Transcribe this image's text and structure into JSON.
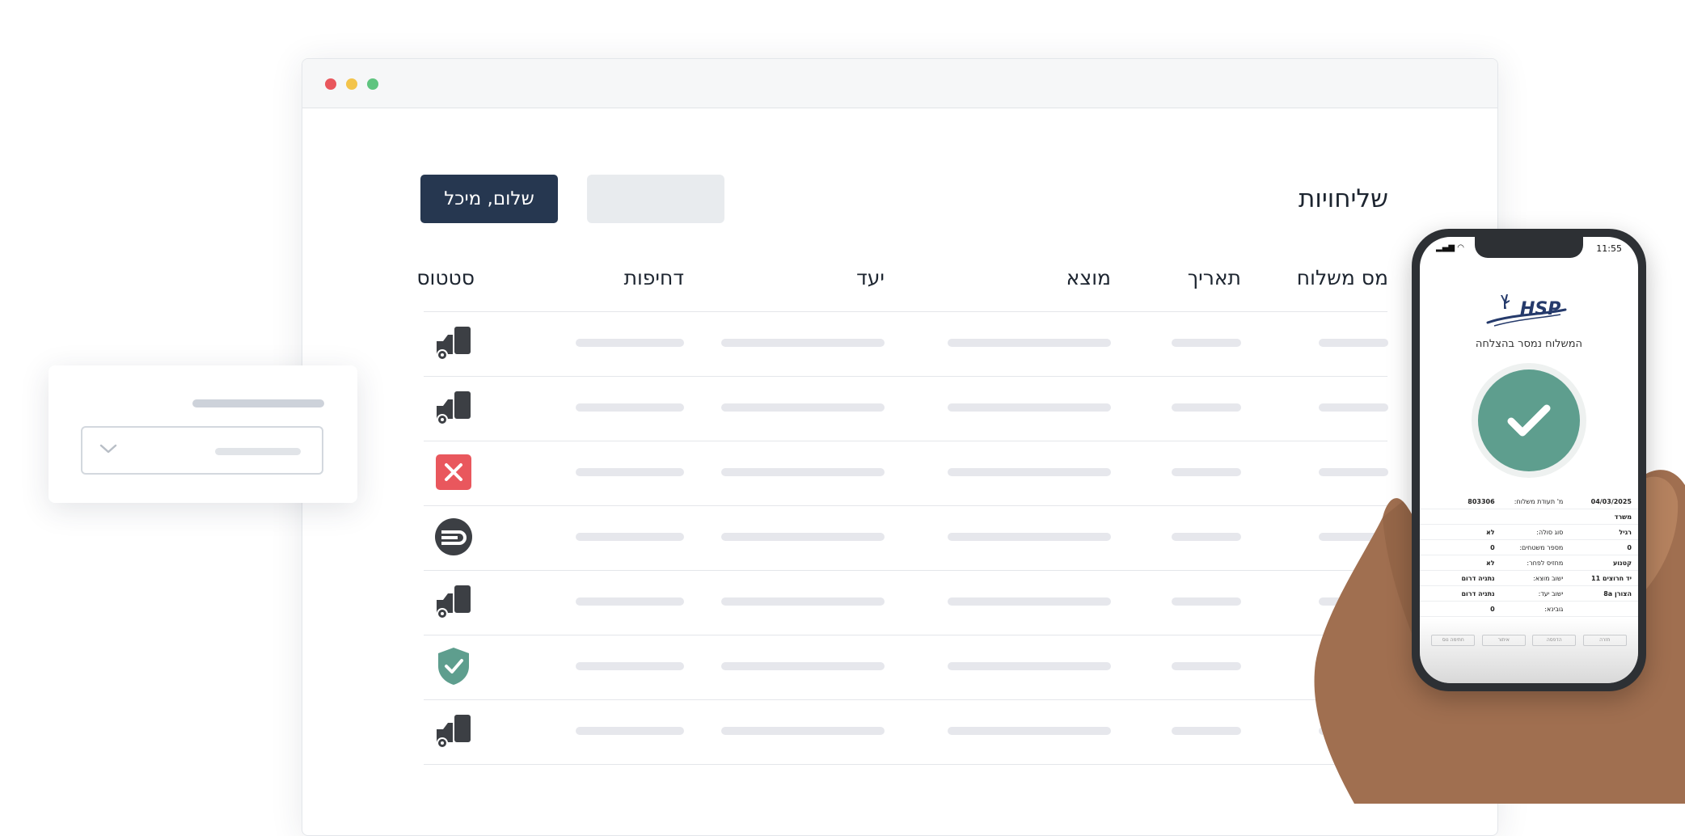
{
  "window": {
    "dots": [
      "red",
      "yellow",
      "green"
    ]
  },
  "header": {
    "title": "שליחויות",
    "greeting_button": "שלום, מיכל"
  },
  "table": {
    "columns": [
      "מס משלוח",
      "תאריך",
      "מוצא",
      "יעד",
      "דחיפות",
      "סטטוס"
    ],
    "rows": [
      {
        "status_icon": "truck-icon"
      },
      {
        "status_icon": "truck-icon"
      },
      {
        "status_icon": "cancel-icon"
      },
      {
        "status_icon": "delivered-package-icon"
      },
      {
        "status_icon": "truck-icon"
      },
      {
        "status_icon": "shield-check-icon"
      },
      {
        "status_icon": "truck-icon"
      }
    ]
  },
  "float_card": {
    "icon": "chevron-down-icon"
  },
  "phone": {
    "time": "11:55",
    "logo_text": "HSP",
    "success_message": "המשלוח נמסר בהצלחה",
    "details": [
      [
        "04/03/2025",
        "מ' תעודת משלוח:",
        "803306"
      ],
      [
        "משרד",
        "",
        ""
      ],
      [
        "רגיל",
        "סוג סולה:",
        "לא"
      ],
      [
        "0",
        "מספר משטחים:",
        "0"
      ],
      [
        "קטנוע",
        "מחזיס לפחר:",
        "לא"
      ],
      [
        "יד חרוצים 11",
        "ישוב מוצא:",
        "נתניה דרום"
      ],
      [
        "הצורן 8a",
        "ישוב יעד:",
        "נתניה דרום"
      ],
      [
        "",
        "גובינא:",
        "0"
      ]
    ],
    "actions": [
      "חזרה",
      "הדפסה",
      "איתור",
      "חתימה נוס"
    ]
  },
  "colors": {
    "primary": "#263750",
    "success": "#5e9e8e",
    "danger": "#e9575d",
    "icon_dark": "#3c3f44"
  }
}
